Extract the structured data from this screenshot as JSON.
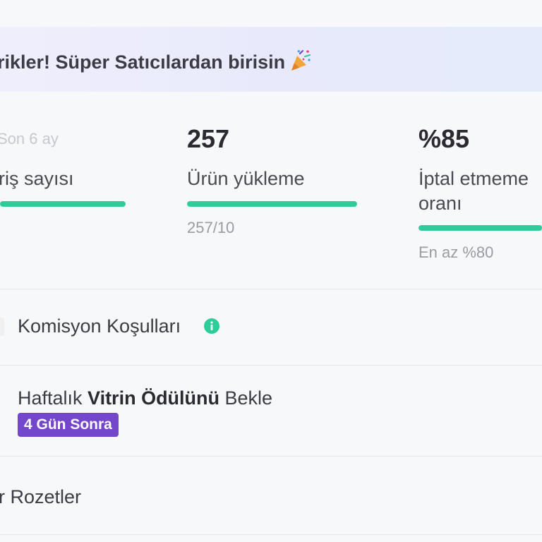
{
  "banner": {
    "text": "rikler! Süper Satıcılardan birisin",
    "icon": "party-popper-icon"
  },
  "metrics": {
    "period_caption": "Son 6 ay",
    "items": [
      {
        "value": "",
        "label": "riş sayısı",
        "progress": 1.0,
        "sub": ""
      },
      {
        "value": "257",
        "label": "Ürün yükleme",
        "progress": 1.0,
        "sub": "257/10"
      },
      {
        "value": "%85",
        "label_line1": "İptal etmeme",
        "label_line2": "oranı",
        "progress": 1.0,
        "sub": "En az %80"
      }
    ]
  },
  "rows": {
    "commission": {
      "label": "Komisyon Koşulları",
      "icon": "info-icon"
    },
    "weekly": {
      "prefix": "Haftalık ",
      "bold": "Vitrin Ödülünü",
      "suffix": " Bekle",
      "badge": "4 Gün Sonra"
    },
    "badges": {
      "label": "r Rozetler"
    }
  },
  "colors": {
    "accent_green": "#2ecb9b",
    "badge_purple": "#7446c9",
    "info_green": "#2ecb9b"
  }
}
